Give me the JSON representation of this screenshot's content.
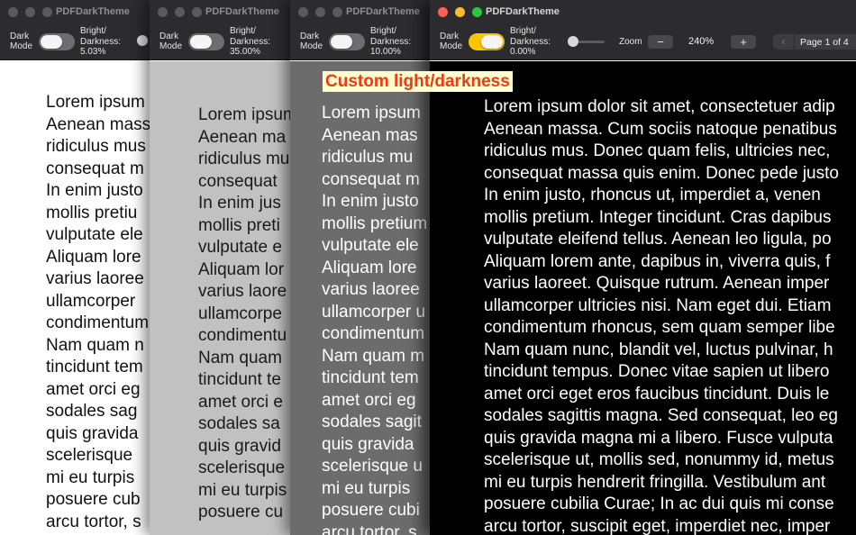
{
  "app_title": "PDFDarkTheme",
  "dark_mode_label": "Dark\nMode",
  "brightness_label": "Bright/\nDarkness:",
  "windows": [
    {
      "brightness_value": "5.03%"
    },
    {
      "brightness_value": "35.00%"
    },
    {
      "brightness_value": "10.00%"
    },
    {
      "brightness_value": "0.00%"
    }
  ],
  "active": {
    "dark_mode_on": true,
    "zoom_label": "Zoom",
    "zoom_value": "240%",
    "zoom_minus": "−",
    "zoom_plus": "+",
    "prev_glyph": "‹",
    "page_indicator": "Page 1 of 4",
    "slider_level": 0.0
  },
  "overlay_label": "Custom light/darkness",
  "pages": {
    "w1": "Lorem ipsum\nAenean massa\nridiculus mus\nconsequat m\nIn enim justo\nmollis pretiu\nvulputate ele\nAliquam lore\nvarius laoree\nullamcorper\ncondimentum\nNam quam n\ntincidunt tem\namet orci eg\nsodales sag\nquis gravida\nscelerisque\nmi eu turpis\nposuere cub\narcu tortor, s",
    "w2": "Lorem ipsum\nAenean ma\nridiculus mu\nconsequat\nIn enim jus\nmollis preti\nvulputate e\nAliquam lor\nvarius laore\nullamcorpe\ncondimentu\nNam quam\ntincidunt te\namet orci e\nsodales sa\nquis gravid\nscelerisque\nmi eu turpis\nposuere cu",
    "w3": "Lorem ipsum\nAenean mas\nridiculus mu\nconsequat m\nIn enim justo\nmollis pretium\nvulputate ele\nAliquam lore\nvarius laoree\nullamcorper u\ncondimentum\nNam quam m\ntincidunt tem\namet orci eg\nsodales sagit\nquis gravida\nscelerisque u\nmi eu turpis\nposuere cubi\narcu tortor, s",
    "w4": "Lorem ipsum dolor sit amet, consectetuer adip\nAenean massa. Cum sociis natoque penatibus\nridiculus mus. Donec quam felis, ultricies nec,\nconsequat massa quis enim. Donec pede justo\nIn enim justo, rhoncus ut, imperdiet a, venen\nmollis pretium. Integer tincidunt. Cras dapibus\nvulputate eleifend tellus. Aenean leo ligula, po\nAliquam lorem ante, dapibus in, viverra quis, f\nvarius laoreet. Quisque rutrum. Aenean imper\nullamcorper ultricies nisi. Nam eget dui. Etiam\ncondimentum rhoncus, sem quam semper libe\nNam quam nunc, blandit vel, luctus pulvinar, h\ntincidunt tempus. Donec vitae sapien ut libero\namet orci eget eros faucibus tincidunt. Duis le\nsodales sagittis magna. Sed consequat, leo eg\nquis gravida magna mi a libero. Fusce vulputa\nscelerisque ut, mollis sed, nonummy id, metus\nmi eu turpis hendrerit fringilla. Vestibulum ant\nposuere cubilia Curae; In ac dui quis mi conse\narcu tortor, suscipit eget, imperdiet nec, imper"
  }
}
